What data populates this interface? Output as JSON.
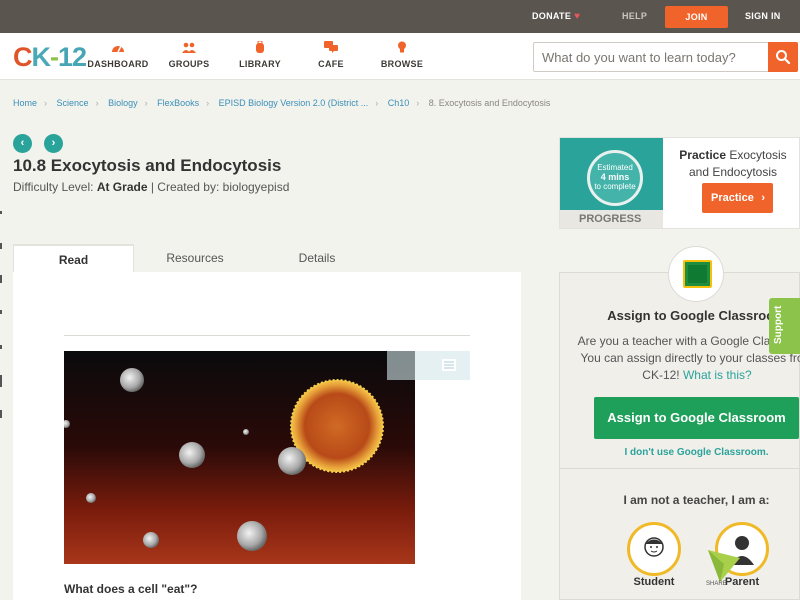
{
  "topbar": {
    "donate": "DONATE",
    "help": "HELP",
    "join": "JOIN",
    "sign_in": "SIGN IN"
  },
  "logo": {
    "c": "C",
    "k": "K",
    "dash": "-",
    "num": "12"
  },
  "nav": {
    "items": [
      {
        "label": "DASHBOARD",
        "icon": "dashboard-gauge-icon"
      },
      {
        "label": "GROUPS",
        "icon": "groups-people-icon"
      },
      {
        "label": "LIBRARY",
        "icon": "library-backpack-icon"
      },
      {
        "label": "CAFE",
        "icon": "cafe-chat-icon"
      },
      {
        "label": "BROWSE",
        "icon": "browse-lightbulb-icon"
      }
    ]
  },
  "search": {
    "placeholder": "What do you want to learn today?",
    "icon": "search-icon"
  },
  "breadcrumb": {
    "items": [
      "Home",
      "Science",
      "Biology",
      "FlexBooks",
      "EPISD Biology Version 2.0 (District ...",
      "Ch10"
    ],
    "current": "8. Exocytosis and Endocytosis"
  },
  "pager": {
    "prev": "‹",
    "next": "›"
  },
  "page": {
    "title": "10.8 Exocytosis and Endocytosis",
    "difficulty_prefix": "Difficulty Level: ",
    "difficulty": "At Grade",
    "created_by": " | Created by: biologyepisd"
  },
  "tabs": [
    "Read",
    "Resources",
    "Details"
  ],
  "content": {
    "question": "What does a cell \"eat\"?"
  },
  "practice": {
    "estimated": "Estimated",
    "mins": "4 mins",
    "to_complete": "to complete",
    "progress": "PROGRESS",
    "heading_bold": "Practice",
    "heading_rest": " Exocytosis and Endocytosis",
    "button": "Practice"
  },
  "classroom": {
    "title": "Assign to Google Classroom",
    "desc": "Are you a teacher with a Google Classroom? You can assign directly to your classes from CK-12! ",
    "what_link": "What is this?",
    "button": "Assign to Google Classroom",
    "no_use": "I don't use Google Classroom.",
    "not_teacher": "I am not a teacher, I am a:",
    "roles": [
      "Student",
      "Parent"
    ]
  },
  "share": "SHARE",
  "support": "Support",
  "colors": {
    "accent": "#f0642b",
    "teal": "#2aa39b",
    "green": "#1fa05a",
    "lime": "#8cc34b"
  }
}
